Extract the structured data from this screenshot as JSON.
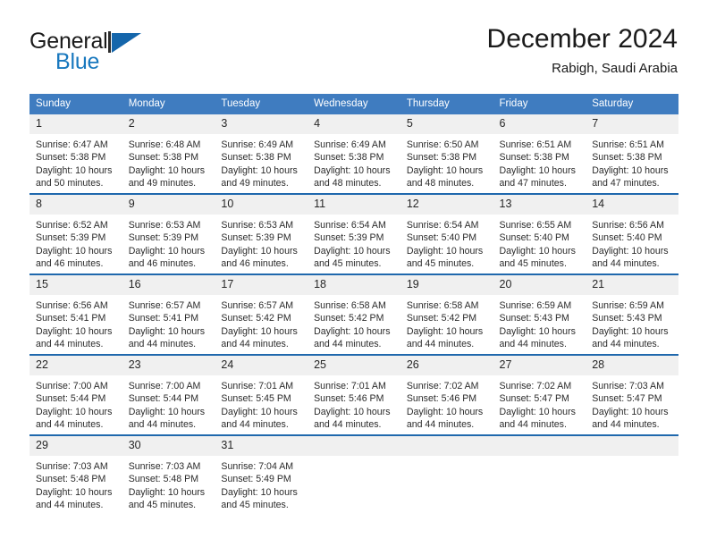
{
  "brand": {
    "name_part1": "General",
    "name_part2": "Blue",
    "logo_icon": "triangle-flag-icon"
  },
  "header": {
    "title": "December 2024",
    "subtitle": "Rabigh, Saudi Arabia"
  },
  "calendar": {
    "weekday_headers": [
      "Sunday",
      "Monday",
      "Tuesday",
      "Wednesday",
      "Thursday",
      "Friday",
      "Saturday"
    ],
    "accent_color": "#3f7cc0",
    "row_separator_color": "#1f68ad",
    "daynum_background": "#f0f0f0",
    "weeks": [
      [
        {
          "day": "1",
          "sunrise": "Sunrise: 6:47 AM",
          "sunset": "Sunset: 5:38 PM",
          "daylight_line1": "Daylight: 10 hours",
          "daylight_line2": "and 50 minutes."
        },
        {
          "day": "2",
          "sunrise": "Sunrise: 6:48 AM",
          "sunset": "Sunset: 5:38 PM",
          "daylight_line1": "Daylight: 10 hours",
          "daylight_line2": "and 49 minutes."
        },
        {
          "day": "3",
          "sunrise": "Sunrise: 6:49 AM",
          "sunset": "Sunset: 5:38 PM",
          "daylight_line1": "Daylight: 10 hours",
          "daylight_line2": "and 49 minutes."
        },
        {
          "day": "4",
          "sunrise": "Sunrise: 6:49 AM",
          "sunset": "Sunset: 5:38 PM",
          "daylight_line1": "Daylight: 10 hours",
          "daylight_line2": "and 48 minutes."
        },
        {
          "day": "5",
          "sunrise": "Sunrise: 6:50 AM",
          "sunset": "Sunset: 5:38 PM",
          "daylight_line1": "Daylight: 10 hours",
          "daylight_line2": "and 48 minutes."
        },
        {
          "day": "6",
          "sunrise": "Sunrise: 6:51 AM",
          "sunset": "Sunset: 5:38 PM",
          "daylight_line1": "Daylight: 10 hours",
          "daylight_line2": "and 47 minutes."
        },
        {
          "day": "7",
          "sunrise": "Sunrise: 6:51 AM",
          "sunset": "Sunset: 5:38 PM",
          "daylight_line1": "Daylight: 10 hours",
          "daylight_line2": "and 47 minutes."
        }
      ],
      [
        {
          "day": "8",
          "sunrise": "Sunrise: 6:52 AM",
          "sunset": "Sunset: 5:39 PM",
          "daylight_line1": "Daylight: 10 hours",
          "daylight_line2": "and 46 minutes."
        },
        {
          "day": "9",
          "sunrise": "Sunrise: 6:53 AM",
          "sunset": "Sunset: 5:39 PM",
          "daylight_line1": "Daylight: 10 hours",
          "daylight_line2": "and 46 minutes."
        },
        {
          "day": "10",
          "sunrise": "Sunrise: 6:53 AM",
          "sunset": "Sunset: 5:39 PM",
          "daylight_line1": "Daylight: 10 hours",
          "daylight_line2": "and 46 minutes."
        },
        {
          "day": "11",
          "sunrise": "Sunrise: 6:54 AM",
          "sunset": "Sunset: 5:39 PM",
          "daylight_line1": "Daylight: 10 hours",
          "daylight_line2": "and 45 minutes."
        },
        {
          "day": "12",
          "sunrise": "Sunrise: 6:54 AM",
          "sunset": "Sunset: 5:40 PM",
          "daylight_line1": "Daylight: 10 hours",
          "daylight_line2": "and 45 minutes."
        },
        {
          "day": "13",
          "sunrise": "Sunrise: 6:55 AM",
          "sunset": "Sunset: 5:40 PM",
          "daylight_line1": "Daylight: 10 hours",
          "daylight_line2": "and 45 minutes."
        },
        {
          "day": "14",
          "sunrise": "Sunrise: 6:56 AM",
          "sunset": "Sunset: 5:40 PM",
          "daylight_line1": "Daylight: 10 hours",
          "daylight_line2": "and 44 minutes."
        }
      ],
      [
        {
          "day": "15",
          "sunrise": "Sunrise: 6:56 AM",
          "sunset": "Sunset: 5:41 PM",
          "daylight_line1": "Daylight: 10 hours",
          "daylight_line2": "and 44 minutes."
        },
        {
          "day": "16",
          "sunrise": "Sunrise: 6:57 AM",
          "sunset": "Sunset: 5:41 PM",
          "daylight_line1": "Daylight: 10 hours",
          "daylight_line2": "and 44 minutes."
        },
        {
          "day": "17",
          "sunrise": "Sunrise: 6:57 AM",
          "sunset": "Sunset: 5:42 PM",
          "daylight_line1": "Daylight: 10 hours",
          "daylight_line2": "and 44 minutes."
        },
        {
          "day": "18",
          "sunrise": "Sunrise: 6:58 AM",
          "sunset": "Sunset: 5:42 PM",
          "daylight_line1": "Daylight: 10 hours",
          "daylight_line2": "and 44 minutes."
        },
        {
          "day": "19",
          "sunrise": "Sunrise: 6:58 AM",
          "sunset": "Sunset: 5:42 PM",
          "daylight_line1": "Daylight: 10 hours",
          "daylight_line2": "and 44 minutes."
        },
        {
          "day": "20",
          "sunrise": "Sunrise: 6:59 AM",
          "sunset": "Sunset: 5:43 PM",
          "daylight_line1": "Daylight: 10 hours",
          "daylight_line2": "and 44 minutes."
        },
        {
          "day": "21",
          "sunrise": "Sunrise: 6:59 AM",
          "sunset": "Sunset: 5:43 PM",
          "daylight_line1": "Daylight: 10 hours",
          "daylight_line2": "and 44 minutes."
        }
      ],
      [
        {
          "day": "22",
          "sunrise": "Sunrise: 7:00 AM",
          "sunset": "Sunset: 5:44 PM",
          "daylight_line1": "Daylight: 10 hours",
          "daylight_line2": "and 44 minutes."
        },
        {
          "day": "23",
          "sunrise": "Sunrise: 7:00 AM",
          "sunset": "Sunset: 5:44 PM",
          "daylight_line1": "Daylight: 10 hours",
          "daylight_line2": "and 44 minutes."
        },
        {
          "day": "24",
          "sunrise": "Sunrise: 7:01 AM",
          "sunset": "Sunset: 5:45 PM",
          "daylight_line1": "Daylight: 10 hours",
          "daylight_line2": "and 44 minutes."
        },
        {
          "day": "25",
          "sunrise": "Sunrise: 7:01 AM",
          "sunset": "Sunset: 5:46 PM",
          "daylight_line1": "Daylight: 10 hours",
          "daylight_line2": "and 44 minutes."
        },
        {
          "day": "26",
          "sunrise": "Sunrise: 7:02 AM",
          "sunset": "Sunset: 5:46 PM",
          "daylight_line1": "Daylight: 10 hours",
          "daylight_line2": "and 44 minutes."
        },
        {
          "day": "27",
          "sunrise": "Sunrise: 7:02 AM",
          "sunset": "Sunset: 5:47 PM",
          "daylight_line1": "Daylight: 10 hours",
          "daylight_line2": "and 44 minutes."
        },
        {
          "day": "28",
          "sunrise": "Sunrise: 7:03 AM",
          "sunset": "Sunset: 5:47 PM",
          "daylight_line1": "Daylight: 10 hours",
          "daylight_line2": "and 44 minutes."
        }
      ],
      [
        {
          "day": "29",
          "sunrise": "Sunrise: 7:03 AM",
          "sunset": "Sunset: 5:48 PM",
          "daylight_line1": "Daylight: 10 hours",
          "daylight_line2": "and 44 minutes."
        },
        {
          "day": "30",
          "sunrise": "Sunrise: 7:03 AM",
          "sunset": "Sunset: 5:48 PM",
          "daylight_line1": "Daylight: 10 hours",
          "daylight_line2": "and 45 minutes."
        },
        {
          "day": "31",
          "sunrise": "Sunrise: 7:04 AM",
          "sunset": "Sunset: 5:49 PM",
          "daylight_line1": "Daylight: 10 hours",
          "daylight_line2": "and 45 minutes."
        },
        {
          "day": "",
          "sunrise": "",
          "sunset": "",
          "daylight_line1": "",
          "daylight_line2": ""
        },
        {
          "day": "",
          "sunrise": "",
          "sunset": "",
          "daylight_line1": "",
          "daylight_line2": ""
        },
        {
          "day": "",
          "sunrise": "",
          "sunset": "",
          "daylight_line1": "",
          "daylight_line2": ""
        },
        {
          "day": "",
          "sunrise": "",
          "sunset": "",
          "daylight_line1": "",
          "daylight_line2": ""
        }
      ]
    ]
  }
}
